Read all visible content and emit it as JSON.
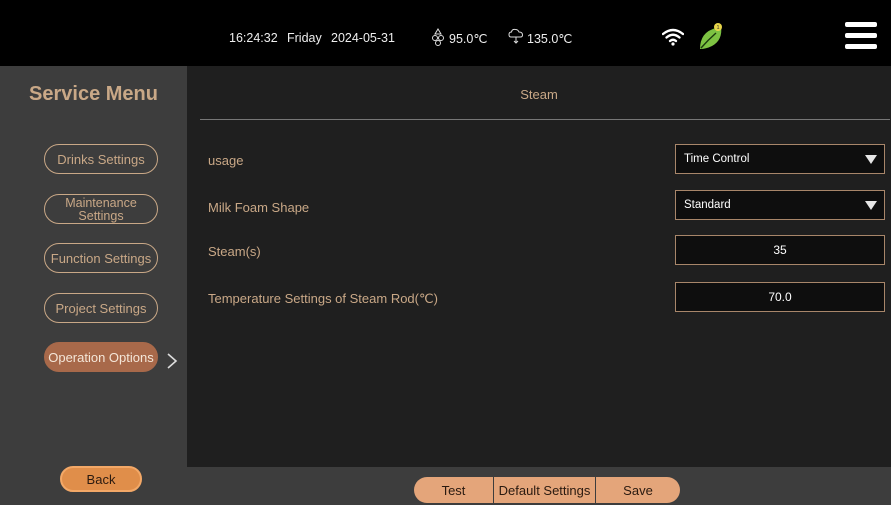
{
  "status_bar": {
    "time": "16:24:32",
    "day": "Friday",
    "date": "2024-05-31",
    "temp1": "95.0℃",
    "temp2": "135.0℃",
    "icons": [
      "droplet-temp-icon",
      "steam-temp-icon",
      "wifi-icon",
      "eco-leaf-icon",
      "menu-icon"
    ],
    "leaf_color": "#7dc242"
  },
  "sidebar": {
    "title": "Service Menu",
    "items": [
      {
        "label": "Drinks Settings"
      },
      {
        "label": "Maintenance Settings"
      },
      {
        "label": "Function Settings"
      },
      {
        "label": "Project Settings"
      },
      {
        "label": "Operation Options",
        "active": true
      }
    ],
    "back_label": "Back"
  },
  "main": {
    "title": "Steam",
    "rows": [
      {
        "label": "usage",
        "type": "select",
        "value": "Time Control"
      },
      {
        "label": "Milk Foam Shape",
        "type": "select",
        "value": "Standard"
      },
      {
        "label": "Steam(s)",
        "type": "input",
        "value": "35"
      },
      {
        "label": "Temperature Settings of Steam Rod(℃)",
        "type": "input",
        "value": "70.0"
      }
    ]
  },
  "bottom_bar": {
    "test_label": "Test",
    "default_label": "Default Settings",
    "save_label": "Save"
  },
  "colors": {
    "accent_text": "#c9a887",
    "active_button": "#a8694a",
    "back_button": "#e08e4a",
    "action_buttons": "#e4a57a"
  }
}
